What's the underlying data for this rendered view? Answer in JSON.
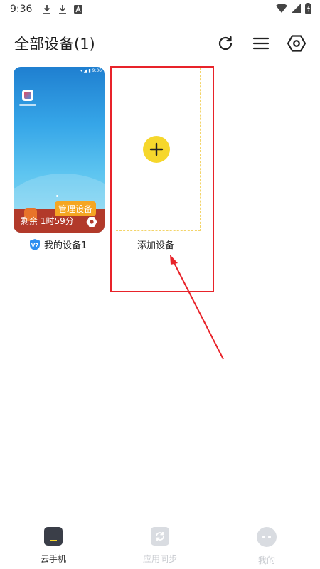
{
  "status_bar": {
    "time": "9:36"
  },
  "header": {
    "title": "全部设备(1)"
  },
  "device": {
    "name": "我的设备1",
    "manage_label": "管理设备",
    "remaining": "剩余 1时59分",
    "brand_badge": "V7"
  },
  "add_device": {
    "label": "添加设备"
  },
  "bottom_nav": {
    "items": [
      {
        "label": "云手机",
        "active": true
      },
      {
        "label": "应用同步",
        "active": false
      },
      {
        "label": "我的",
        "active": false
      }
    ]
  },
  "colors": {
    "accent_yellow": "#f6d72c",
    "highlight_red": "#e8232a",
    "badge_orange": "#f5a623"
  }
}
